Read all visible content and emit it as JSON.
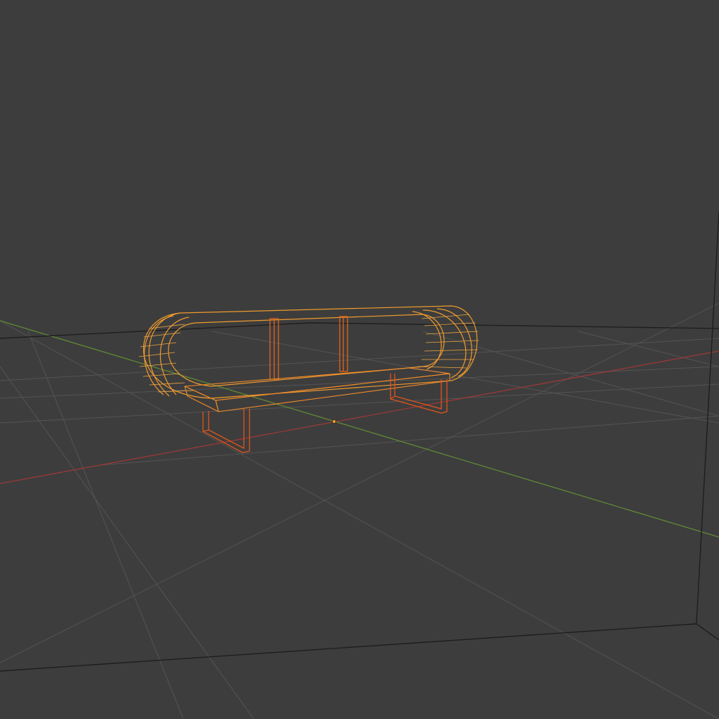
{
  "app": "3D Viewport",
  "viewport": {
    "shading": "wireframe",
    "background_color": "#3d3d3d"
  },
  "grid": {
    "line_color": "#555555",
    "axis_x_color": "#a33b3b",
    "axis_y_color": "#5e8a36"
  },
  "room": {
    "edge_color": "#1f1f1f"
  },
  "object": {
    "type": "sofa-wireframe",
    "selected": true,
    "active_color": "#f29b2c",
    "selected_color": "#e25b12"
  },
  "origin_icon": "object-origin-dot",
  "icons": [
    "object-origin-dot"
  ]
}
